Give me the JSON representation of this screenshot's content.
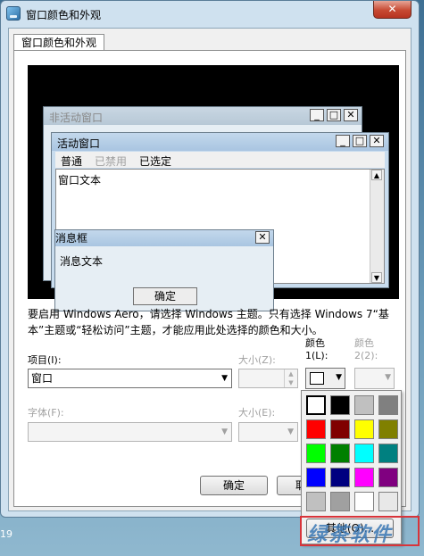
{
  "window": {
    "title": "窗口颜色和外观",
    "close_label": "✕"
  },
  "tab": {
    "label": "窗口颜色和外观"
  },
  "preview": {
    "inactive_title": "非活动窗口",
    "active_title": "活动窗口",
    "menu": {
      "normal": "普通",
      "disabled": "已禁用",
      "selected": "已选定"
    },
    "window_text": "窗口文本",
    "message_title": "消息框",
    "message_text": "消息文本",
    "ok_label": "确定",
    "btn_min": "_",
    "btn_max": "□",
    "btn_close": "✕"
  },
  "description": "要启用 Windows Aero，请选择 Windows 主题。只有选择 Windows 7“基本”主题或“轻松访问”主题，才能应用此处选择的颜色和大小。",
  "item": {
    "label": "项目(I):",
    "value": "窗口"
  },
  "size1": {
    "label": "大小(Z):",
    "value": ""
  },
  "color1": {
    "label_top": "颜色",
    "label_bottom": "1(L):"
  },
  "color2": {
    "label_top": "颜色",
    "label_bottom": "2(2):"
  },
  "font": {
    "label": "字体(F):",
    "value": ""
  },
  "size2": {
    "label": "大小(E):",
    "value": ""
  },
  "buttons": {
    "ok": "确定",
    "cancel_partial": "取"
  },
  "palette": {
    "colors": [
      "#ffffff",
      "#000000",
      "#c0c0c0",
      "#808080",
      "#ff0000",
      "#800000",
      "#ffff00",
      "#808000",
      "#00ff00",
      "#008000",
      "#00ffff",
      "#008080",
      "#0000ff",
      "#000080",
      "#ff00ff",
      "#800080",
      "#c0c0c0",
      "#a0a0a0",
      "#ffffff",
      "#e8e8e8"
    ],
    "other_label": "其他(O)..."
  },
  "watermark": {
    "text": "绿茶软件"
  },
  "taskbar": {
    "text": "19"
  }
}
